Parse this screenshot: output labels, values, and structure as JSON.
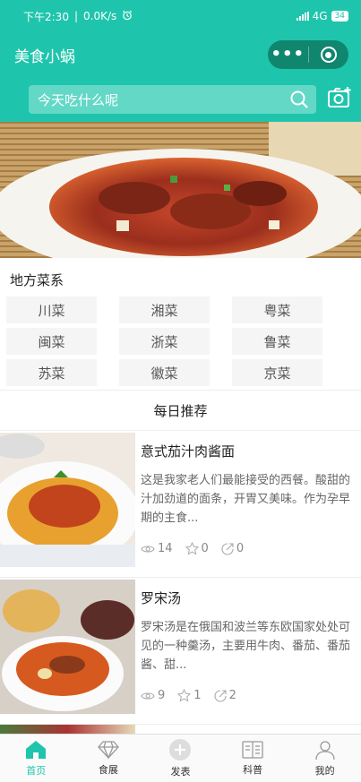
{
  "status_bar": {
    "time": "下午2:30",
    "speed": "0.0K/s",
    "network": "4G",
    "battery": "34"
  },
  "nav": {
    "title": "美食小蜗"
  },
  "search": {
    "placeholder": "今天吃什么呢"
  },
  "cuisines": {
    "label": "地方菜系",
    "items": [
      "川菜",
      "湘菜",
      "粤菜",
      "闽菜",
      "浙菜",
      "鲁菜",
      "苏菜",
      "徽菜",
      "京菜"
    ]
  },
  "daily": {
    "title": "每日推荐",
    "recipes": [
      {
        "title": "意式茄汁肉酱面",
        "desc": "这是我家老人们最能接受的西餐。酸甜的汁加劲道的面条，开胃又美味。作为孕早期的主食...",
        "views": "14",
        "stars": "0",
        "shares": "0"
      },
      {
        "title": "罗宋汤",
        "desc": "罗宋汤是在俄国和波兰等东欧国家处处可见的一种羹汤，主要用牛肉、番茄、番茄酱、甜...",
        "views": "9",
        "stars": "1",
        "shares": "2"
      }
    ]
  },
  "tabbar": [
    {
      "label": "首页",
      "icon": "home-icon",
      "active": true
    },
    {
      "label": "食展",
      "icon": "diamond-icon",
      "active": false
    },
    {
      "label": "发表",
      "icon": "plus-circle-icon",
      "active": false
    },
    {
      "label": "科普",
      "icon": "book-icon",
      "active": false
    },
    {
      "label": "我的",
      "icon": "user-icon",
      "active": false
    }
  ],
  "colors": {
    "primary": "#1ec5ac",
    "capsule": "#11866f",
    "search_box": "#63d8c7"
  }
}
